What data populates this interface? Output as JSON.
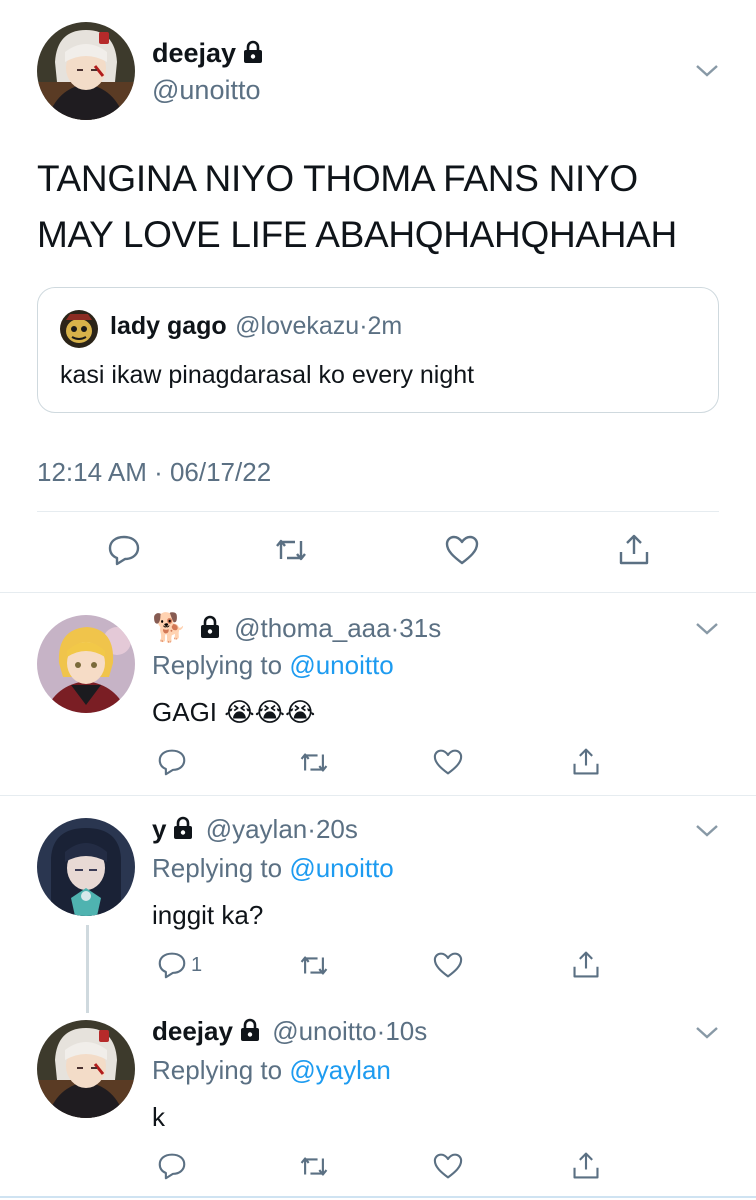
{
  "main_tweet": {
    "name": "deejay",
    "handle": "@unoitto",
    "text_line1": "TANGINA NIYO THOMA FANS NIYO",
    "text_line2": "MAY LOVE LIFE ABAHQHAHQHAHAH",
    "quote": {
      "name": "lady gago",
      "handle": "@lovekazu",
      "time": "2m",
      "text": "kasi ikaw pinagdarasal ko every night"
    },
    "timestamp": "12:14 AM · 06/17/22"
  },
  "replies": [
    {
      "emoji": "🐕",
      "name": "",
      "handle": "@thoma_aaa",
      "time": "31s",
      "replying_prefix": "Replying to",
      "replying_to": "@unoitto",
      "text": "GAGI 😭😭😭",
      "reply_count": ""
    },
    {
      "emoji": "",
      "name": "y",
      "handle": "@yaylan",
      "time": "20s",
      "replying_prefix": "Replying to",
      "replying_to": "@unoitto",
      "text": "inggit ka?",
      "reply_count": "1"
    },
    {
      "emoji": "",
      "name": "deejay",
      "handle": "@unoitto",
      "time": "10s",
      "replying_prefix": "Replying to",
      "replying_to": "@yaylan",
      "text": "k",
      "reply_count": ""
    }
  ],
  "icons": {
    "reply": "reply-icon",
    "retweet": "retweet-icon",
    "like": "heart-icon",
    "share": "share-icon",
    "lock": "lock-icon",
    "more": "chevron-down-icon"
  },
  "colors": {
    "text": "#0f1419",
    "secondary": "#5b7083",
    "link": "#1d9bf0",
    "border": "#cfd9de",
    "divider": "#e6ecf0"
  }
}
